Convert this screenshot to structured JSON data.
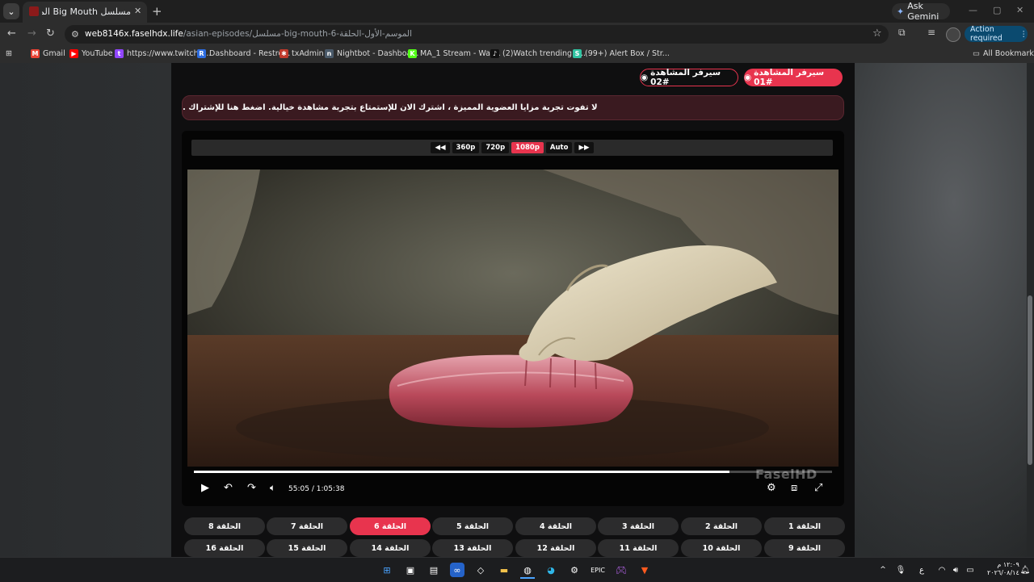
{
  "browser": {
    "tab_title": "مسلسل Big Mouth الموسم الأول",
    "tab_close": "✕",
    "new_tab": "+",
    "gemini_label": "Ask Gemini",
    "url_host": "web8146x.faselhdx.life",
    "url_path": "/asian-episodes/مسلسل-big-mouth-6-الموسم-الأول-الحلقة",
    "action_required": "Action required",
    "window_controls": {
      "minimize": "—",
      "maximize": "▢",
      "close": "✕"
    }
  },
  "bookmarks": [
    {
      "label": "Gmail",
      "icon": "gmail-icon",
      "color": "#ea4335",
      "glyph": "M"
    },
    {
      "label": "YouTube",
      "icon": "youtube-icon",
      "color": "#ff0000",
      "glyph": "▶"
    },
    {
      "label": "https://www.twitch.t...",
      "icon": "twitch-icon",
      "color": "#9146ff",
      "glyph": "t"
    },
    {
      "label": "Dashboard - Restre...",
      "icon": "restream-icon",
      "color": "#2d6cdf",
      "glyph": "R"
    },
    {
      "label": "txAdmin",
      "icon": "txadmin-icon",
      "color": "#c0392b",
      "glyph": "✱"
    },
    {
      "label": "Nightbot - Dashboa...",
      "icon": "nightbot-icon",
      "color": "#4a5a6a",
      "glyph": "n"
    },
    {
      "label": "MA_1 Stream - Wat...",
      "icon": "kick-icon",
      "color": "#53fc18",
      "glyph": "K"
    },
    {
      "label": "(2)Watch trending v...",
      "icon": "tiktok-icon",
      "color": "#111111",
      "glyph": "♪"
    },
    {
      "label": "(99+) Alert Box / Str...",
      "icon": "streamlabs-icon",
      "color": "#31c3a2",
      "glyph": "S"
    }
  ],
  "all_bookmarks": "All Bookmarks",
  "servers": {
    "server1": "سيرفر المشاهدة #01",
    "server2": "سيرفر المشاهدة #02"
  },
  "promo_text": "لا تفوت تجربة مزايا العضوية المميزة ، اشترك الان للإستمتاع بتجربة مشاهدة خيالية. اضغط هنا للإشتراك .",
  "quality": {
    "prev": "◀◀",
    "options": [
      "360p",
      "720p",
      "1080p",
      "Auto"
    ],
    "selected": "1080p",
    "next": "▶▶"
  },
  "player": {
    "current_time": "55:05",
    "separator": "/",
    "duration": "1:05:38",
    "progress": 0.839,
    "watermark": "FaselHD",
    "accent": "#e8344e"
  },
  "episodes": [
    {
      "label": "الحلقة 1",
      "current": false
    },
    {
      "label": "الحلقة 2",
      "current": false
    },
    {
      "label": "الحلقة 3",
      "current": false
    },
    {
      "label": "الحلقة 4",
      "current": false
    },
    {
      "label": "الحلقة 5",
      "current": false
    },
    {
      "label": "الحلقة 6",
      "current": true
    },
    {
      "label": "الحلقة 7",
      "current": false
    },
    {
      "label": "الحلقة 8",
      "current": false
    },
    {
      "label": "الحلقة 9",
      "current": false
    },
    {
      "label": "الحلقة 10",
      "current": false
    },
    {
      "label": "الحلقة 11",
      "current": false
    },
    {
      "label": "الحلقة 12",
      "current": false
    },
    {
      "label": "الحلقة 13",
      "current": false
    },
    {
      "label": "الحلقة 14",
      "current": false
    },
    {
      "label": "الحلقة 15",
      "current": false
    },
    {
      "label": "الحلقة 16",
      "current": false
    }
  ],
  "taskbar": {
    "lang": "ع",
    "time": "١٢:٠٩ م",
    "date": "٢٠٢٦/٠٨/١٤"
  }
}
